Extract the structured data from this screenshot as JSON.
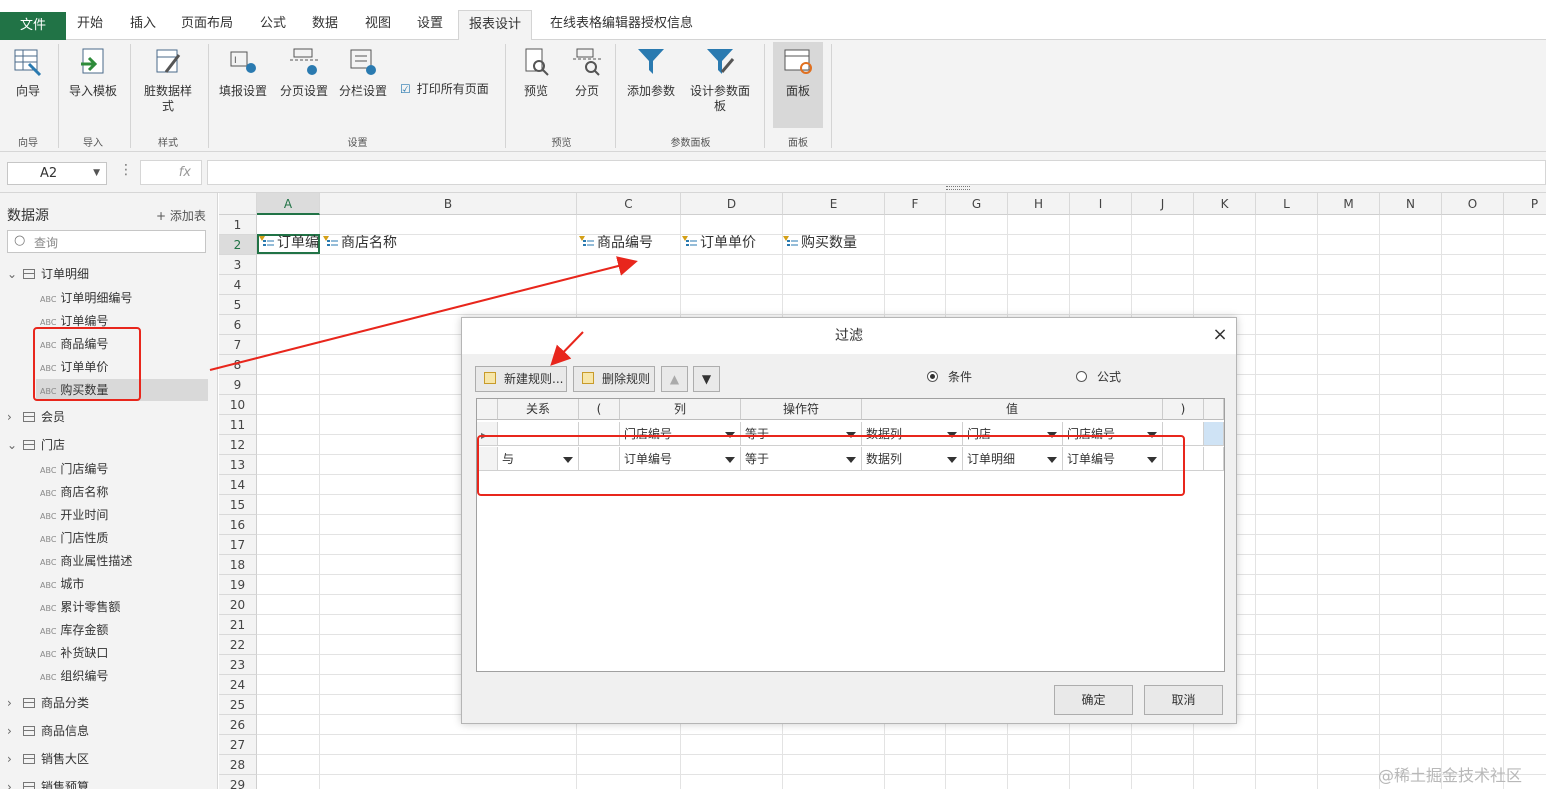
{
  "tabs": [
    "文件",
    "开始",
    "插入",
    "页面布局",
    "公式",
    "数据",
    "视图",
    "设置",
    "报表设计",
    "在线表格编辑器授权信息"
  ],
  "active_tab": "报表设计",
  "ribbon": {
    "buttons": {
      "wizard": "向导",
      "import_template": "导入模板",
      "dirty_style": "脏数据样式",
      "fill_settings": "填报设置",
      "page_settings": "分页设置",
      "column_settings": "分栏设置",
      "print_all": "打印所有页面",
      "preview": "预览",
      "paging": "分页",
      "add_param": "添加参数",
      "design_param": "设计参数面板",
      "panel": "面板"
    },
    "groups": {
      "wizard": "向导",
      "import": "导入",
      "style": "样式",
      "settings": "设置",
      "preview": "预览",
      "param_panel": "参数面板",
      "panel": "面板"
    }
  },
  "formula_bar": {
    "cell_ref": "A2",
    "fx": "fx"
  },
  "sidebar": {
    "title": "数据源",
    "add_table": "+ 添加表",
    "search_placeholder": "查询",
    "abc": "ABC",
    "tables": [
      {
        "name": "订单明细",
        "expanded": true,
        "fields": [
          "订单明细编号",
          "订单编号",
          "商品编号",
          "订单单价",
          "购买数量"
        ]
      },
      {
        "name": "会员",
        "expanded": false,
        "fields": []
      },
      {
        "name": "门店",
        "expanded": true,
        "fields": [
          "门店编号",
          "商店名称",
          "开业时间",
          "门店性质",
          "商业属性描述",
          "城市",
          "累计零售额",
          "库存金额",
          "补货缺口",
          "组织编号"
        ]
      },
      {
        "name": "商品分类",
        "expanded": false,
        "fields": []
      },
      {
        "name": "商品信息",
        "expanded": false,
        "fields": []
      },
      {
        "name": "销售大区",
        "expanded": false,
        "fields": []
      },
      {
        "name": "销售预算",
        "expanded": false,
        "fields": []
      }
    ]
  },
  "grid": {
    "columns": [
      "A",
      "B",
      "C",
      "D",
      "E",
      "F",
      "G",
      "H",
      "I",
      "J",
      "K",
      "L",
      "M",
      "N",
      "O",
      "P"
    ],
    "rows": [
      "1",
      "2",
      "3",
      "4",
      "5",
      "6",
      "7",
      "8",
      "9",
      "10",
      "11",
      "12",
      "13",
      "14",
      "15",
      "16",
      "17",
      "18",
      "19",
      "20",
      "21",
      "22",
      "23",
      "24",
      "25",
      "26",
      "27",
      "28",
      "29"
    ],
    "row2": {
      "A": "订单编",
      "B": "商店名称",
      "C": "商品编号",
      "D": "订单单价",
      "E": "购买数量"
    }
  },
  "dialog": {
    "title": "过滤",
    "close": "×",
    "new_rule": "新建规则...",
    "delete_rule": "删除规则",
    "radio_condition": "条件",
    "radio_formula": "公式",
    "headers": [
      "关系",
      "(",
      "列",
      "操作符",
      "值",
      ")"
    ],
    "rules": [
      {
        "relation": "",
        "col": "门店编号",
        "op": "等于",
        "vtype": "数据列",
        "vtable": "门店",
        "vfield": "门店编号"
      },
      {
        "relation": "与",
        "col": "订单编号",
        "op": "等于",
        "vtype": "数据列",
        "vtable": "订单明细",
        "vfield": "订单编号"
      }
    ],
    "ok": "确定",
    "cancel": "取消"
  },
  "watermark": "@稀土掘金技术社区",
  "colors": {
    "accent": "#217346",
    "annotation": "#e8261c"
  }
}
